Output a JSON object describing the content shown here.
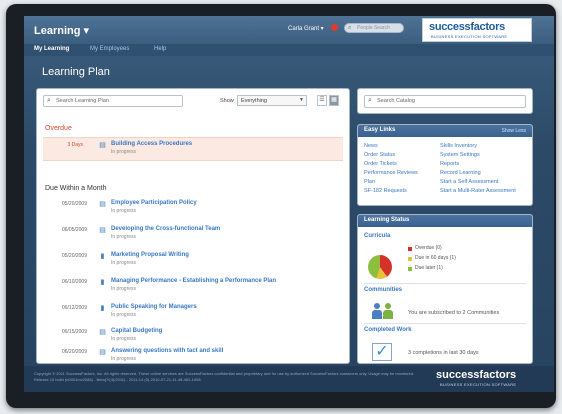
{
  "header": {
    "app_title": "Learning",
    "app_title_arrow": "▾",
    "user_name": "Carla Grant ▾",
    "people_search_placeholder": "People Search",
    "logo_main": "successfactors",
    "logo_sub": "BUSINESS EXECUTION SOFTWARE"
  },
  "nav": {
    "items": [
      {
        "label": "My Learning",
        "active": true
      },
      {
        "label": "My Employees",
        "active": false
      },
      {
        "label": "Help",
        "active": false
      }
    ]
  },
  "page_title": "Learning Plan",
  "main": {
    "search_placeholder": "Search Learning Plan",
    "show_label": "Show",
    "show_value": "Everything",
    "overdue_title": "Overdue",
    "overdue_item": {
      "date": "3 Days",
      "title": "Building Access Procedures",
      "status": "In progress",
      "icon": "document-icon"
    },
    "due_title": "Due Within a Month",
    "due_items": [
      {
        "date": "05/20/2009",
        "title": "Employee Participation Policy",
        "status": "In progress",
        "icon": "document-icon"
      },
      {
        "date": "06/05/2009",
        "title": "Developing the Cross-functional Team",
        "status": "In progress",
        "icon": "document-icon"
      },
      {
        "date": "05/20/2009",
        "title": "Marketing Proposal Writing",
        "status": "In progress",
        "icon": "book-icon"
      },
      {
        "date": "06/10/2009",
        "title": "Managing Performance - Establishing a Performance Plan",
        "status": "In progress",
        "icon": "book-icon"
      },
      {
        "date": "06/12/2009",
        "title": "Public Speaking for Managers",
        "status": "In progress",
        "icon": "book-icon"
      },
      {
        "date": "06/15/2009",
        "title": "Capital Budgeting",
        "status": "In progress",
        "icon": "document-icon"
      },
      {
        "date": "06/20/2009",
        "title": "Answering questions with tact and skill",
        "status": "In progress",
        "icon": "document-icon"
      }
    ]
  },
  "catalog": {
    "search_placeholder": "Search Catalog"
  },
  "easy_links": {
    "title": "Easy Links",
    "show_less": "Show Less",
    "left": [
      "News",
      "Order Status",
      "Order Tickets",
      "Performance Reviews",
      "Plan",
      "SF-182 Requests"
    ],
    "right": [
      "Skills Inventory",
      "System Settings",
      "Reports",
      "Record Learning",
      "Start a Self Assessment",
      "Start a Multi-Rater Assessment"
    ]
  },
  "learning_status": {
    "title": "Learning Status",
    "curricula_label": "Curricula",
    "legend": [
      {
        "label": "Overdue (0)",
        "color": "#d5312a"
      },
      {
        "label": "Due in 60 days (1)",
        "color": "#e6c13a"
      },
      {
        "label": "Due later (1)",
        "color": "#8cbf3e"
      }
    ],
    "communities_label": "Communities",
    "communities_text": "You are subscribed to 2 Communities",
    "completed_label": "Completed Work",
    "completed_text": "3 completions in last 30 days"
  },
  "footer": {
    "copyright": "Copyright © 2011 SuccessFactors, Inc. All rights reserved. These online services are SuccessFactors confidential and proprietary and for use by authorized SuccessFactors customers only. Usage may be monitored. Release 10 build (b0001mv2088) - Beta(7/(4)/2011) - 2011-14 (0)-2010-07-21-11-48-462-1008",
    "logo_main": "successfactors",
    "logo_sub": "BUSINESS EXECUTION SOFTWARE"
  }
}
